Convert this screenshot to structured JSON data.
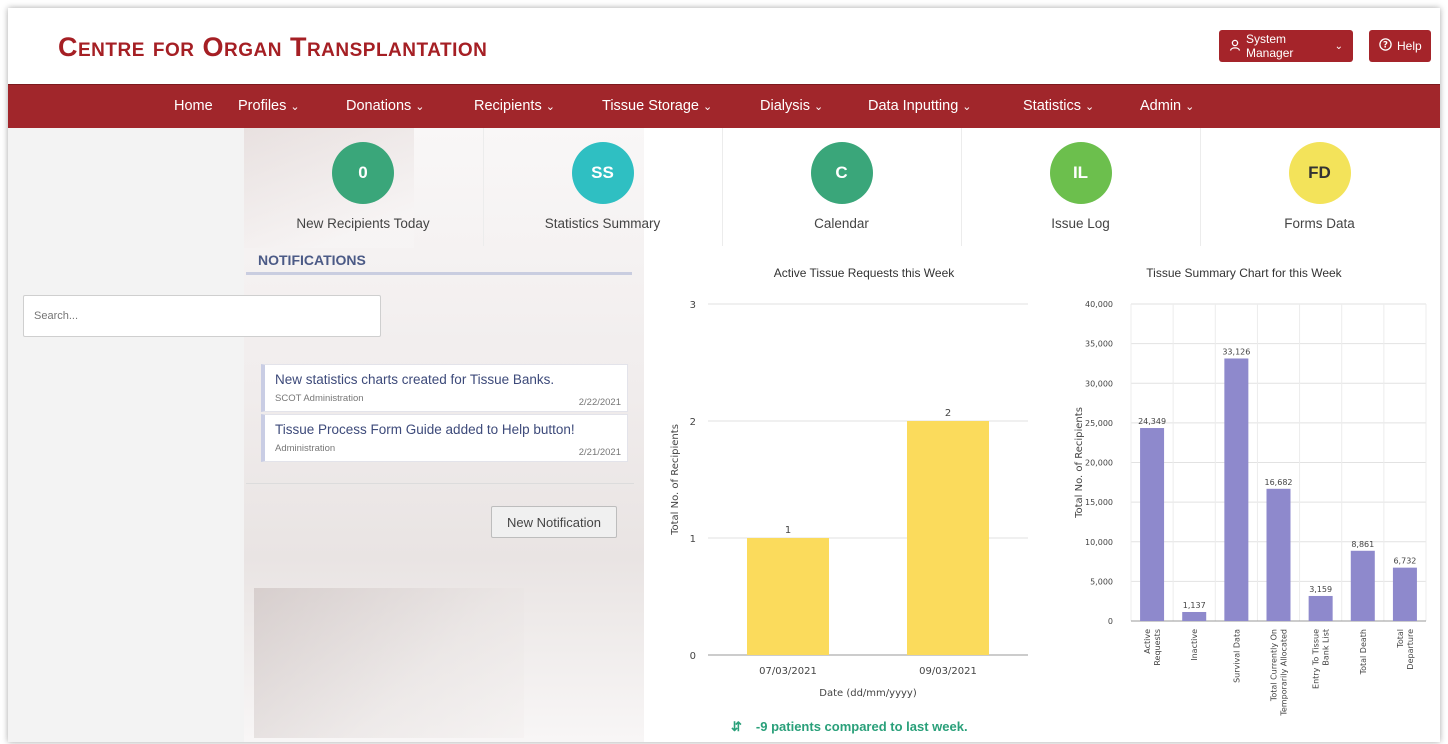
{
  "header": {
    "app_title": "Centre for Organ Transplantation",
    "user_button": "System Manager",
    "help_button": "Help"
  },
  "nav": {
    "items": [
      {
        "label": "Home",
        "has_menu": false
      },
      {
        "label": "Profiles",
        "has_menu": true
      },
      {
        "label": "Donations",
        "has_menu": true
      },
      {
        "label": "Recipients",
        "has_menu": true
      },
      {
        "label": "Tissue Storage",
        "has_menu": true
      },
      {
        "label": "Dialysis",
        "has_menu": true
      },
      {
        "label": "Data Inputting",
        "has_menu": true
      },
      {
        "label": "Statistics",
        "has_menu": true
      },
      {
        "label": "Admin",
        "has_menu": true
      }
    ]
  },
  "tiles": [
    {
      "badge": "0",
      "label": "New Recipients Today",
      "color": "#3aa67a"
    },
    {
      "badge": "SS",
      "label": "Statistics Summary",
      "color": "#2fbfc2"
    },
    {
      "badge": "C",
      "label": "Calendar",
      "color": "#3aa67a"
    },
    {
      "badge": "IL",
      "label": "Issue Log",
      "color": "#6cbf4d"
    },
    {
      "badge": "FD",
      "label": "Forms Data",
      "color": "#f3e35a",
      "text_color": "#333333"
    }
  ],
  "notifications": {
    "title": "NOTIFICATIONS",
    "search_placeholder": "Search...",
    "items": [
      {
        "title": "New statistics charts created for Tissue Banks.",
        "source": "SCOT Administration",
        "date": "2/22/2021"
      },
      {
        "title": "Tissue Process Form Guide added to Help button!",
        "source": "Administration",
        "date": "2/21/2021"
      }
    ],
    "new_button": "New Notification"
  },
  "chart_data": [
    {
      "type": "bar",
      "title": "Active Tissue Requests this Week",
      "xlabel": "Date (dd/mm/yyyy)",
      "ylabel": "Total No. of Recipients",
      "categories": [
        "07/03/2021",
        "09/03/2021"
      ],
      "values": [
        1,
        2
      ],
      "ylim": [
        0,
        3
      ],
      "yticks": [
        0,
        1,
        2,
        3
      ],
      "color": "#fbdb5c",
      "grid": true
    },
    {
      "type": "bar",
      "title": "Tissue Summary Chart for this Week",
      "xlabel": "",
      "ylabel": "Total No. of Recipients",
      "categories": [
        "Active Requests",
        "Inactive",
        "Survival Data",
        "Total Currently On Temporarily Allocated",
        "Entry To Tissue Bank List",
        "Total Death",
        "Total Departure"
      ],
      "values": [
        24349,
        1137,
        33126,
        16682,
        3159,
        8861,
        6732
      ],
      "value_labels": [
        "24,349",
        "1,137",
        "33,126",
        "16,682",
        "3,159",
        "8,861",
        "6,732"
      ],
      "ylim": [
        0,
        40000
      ],
      "yticks": [
        0,
        5000,
        10000,
        15000,
        20000,
        25000,
        30000,
        35000,
        40000
      ],
      "ytick_labels": [
        "0",
        "5,000",
        "10,000",
        "15,000",
        "20,000",
        "25,000",
        "30,000",
        "35,000",
        "40,000"
      ],
      "color": "#8e89cc",
      "grid": true
    }
  ],
  "comparison_note": "-9 patients compared to last week."
}
